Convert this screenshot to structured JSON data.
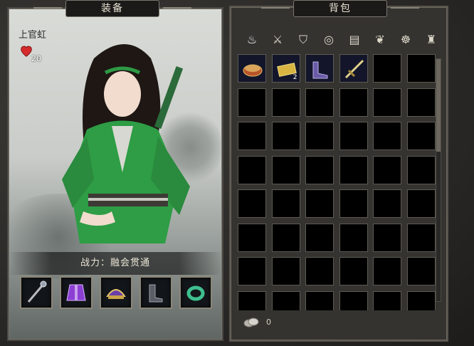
{
  "equip_panel": {
    "title": "装备",
    "char_name": "上官虹",
    "hearts": "20",
    "power_text": "战力：融会贯通",
    "slots": [
      {
        "icon": "staff-icon"
      },
      {
        "icon": "robe-icon"
      },
      {
        "icon": "headgear-icon"
      },
      {
        "icon": "boots-icon"
      },
      {
        "icon": "ring-icon"
      }
    ]
  },
  "bag_panel": {
    "title": "背包",
    "tabs": [
      {
        "icon": "all-items-icon",
        "active": true
      },
      {
        "icon": "weapons-icon"
      },
      {
        "icon": "armor-icon"
      },
      {
        "icon": "accessory-icon"
      },
      {
        "icon": "book-icon"
      },
      {
        "icon": "herb-icon"
      },
      {
        "icon": "misc-icon"
      },
      {
        "icon": "bag-icon"
      }
    ],
    "items": [
      {
        "icon": "food-bowl-icon",
        "qty": ""
      },
      {
        "icon": "golden-tray-icon",
        "qty": "2"
      },
      {
        "icon": "boots-icon",
        "qty": ""
      },
      {
        "icon": "sword-icon",
        "qty": ""
      }
    ],
    "currency": "0"
  }
}
